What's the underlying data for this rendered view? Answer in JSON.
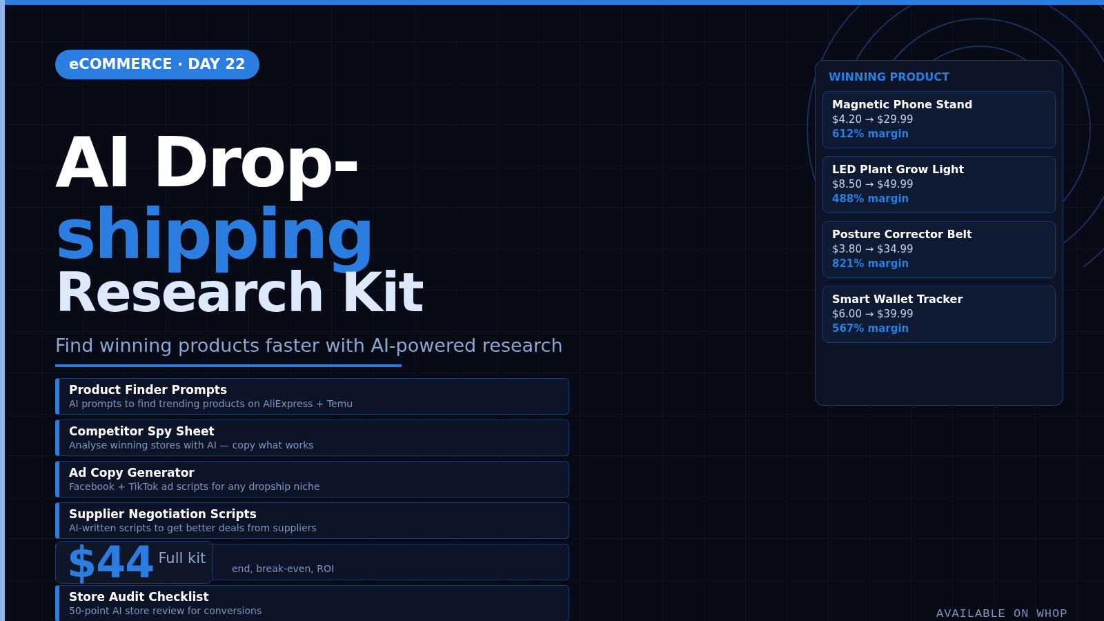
{
  "badge": {
    "category": "eCOMMERCE",
    "separator": "·",
    "day": "DAY 22"
  },
  "title": {
    "line_1": "AI Drop-",
    "line_2": "shipping",
    "line_3": "Research Kit"
  },
  "subtitle": "Find winning products faster with AI-powered research",
  "features": [
    {
      "title": "Product Finder Prompts",
      "description": "AI prompts to find trending products on AliExpress + Temu"
    },
    {
      "title": "Competitor Spy Sheet",
      "description": "Analyse winning stores with AI — copy what works"
    },
    {
      "title": "Ad Copy Generator",
      "description": "Facebook + TikTok ad scripts for any dropship niche"
    },
    {
      "title": "Supplier Negotiation Scripts",
      "description": "AI-written scripts to get better deals from suppliers"
    },
    {
      "description": "end, break-even, ROI"
    },
    {
      "title": "Store Audit Checklist",
      "description": "50-point AI store review for conversions"
    }
  ],
  "price": {
    "amount": "$44",
    "label": "Full kit"
  },
  "panel": {
    "heading": "WINNING PRODUCT",
    "products": [
      {
        "name": "Magnetic Phone Stand",
        "prices": "$4.20 → $29.99",
        "margin": "612% margin"
      },
      {
        "name": "LED Plant Grow Light",
        "prices": "$8.50 → $49.99",
        "margin": "488% margin"
      },
      {
        "name": "Posture Corrector Belt",
        "prices": "$3.80 → $34.99",
        "margin": "821% margin"
      },
      {
        "name": "Smart Wallet Tracker",
        "prices": "$6.00 → $39.99",
        "margin": "567% margin"
      }
    ]
  },
  "footer": "AVAILABLE ON WHOP"
}
